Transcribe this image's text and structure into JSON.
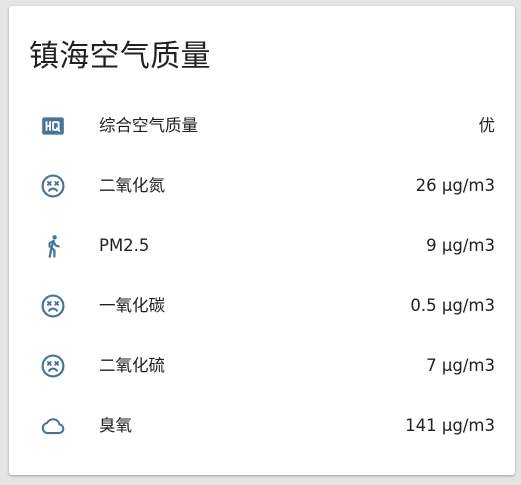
{
  "card": {
    "title": "镇海空气质量"
  },
  "colors": {
    "icon": "#44739e",
    "text": "#212121",
    "background": "#e5e5e5",
    "card": "#ffffff"
  },
  "entities": [
    {
      "icon": "hq-badge-icon",
      "name": "综合空气质量",
      "state": "优"
    },
    {
      "icon": "dizzy-face-icon",
      "name": "二氧化氮",
      "state": "26 μg/m3"
    },
    {
      "icon": "walking-person-icon",
      "name": "PM2.5",
      "state": "9 μg/m3"
    },
    {
      "icon": "dizzy-face-icon",
      "name": "一氧化碳",
      "state": "0.5 μg/m3"
    },
    {
      "icon": "dizzy-face-icon",
      "name": "二氧化硫",
      "state": "7 μg/m3"
    },
    {
      "icon": "cloud-outline-icon",
      "name": "臭氧",
      "state": "141 μg/m3"
    }
  ]
}
